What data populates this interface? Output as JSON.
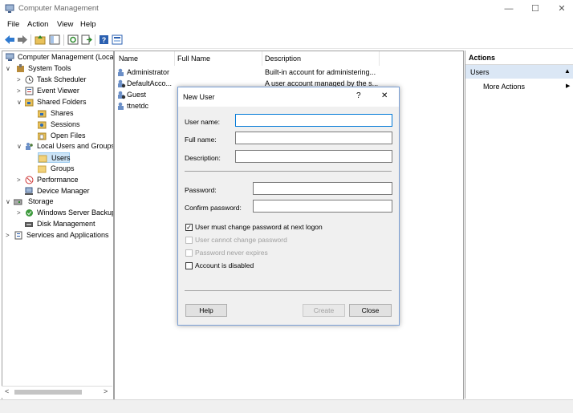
{
  "window": {
    "title": "Computer Management",
    "controls": {
      "minimize": "—",
      "maximize": "☐",
      "close": "✕"
    }
  },
  "menu": [
    "File",
    "Action",
    "View",
    "Help"
  ],
  "toolbar": [
    "back-icon",
    "forward-icon",
    "up-folder-icon",
    "show-hide-tree-icon",
    "refresh-icon",
    "export-list-icon",
    "help-icon",
    "properties-icon"
  ],
  "tree": {
    "items": [
      {
        "label": "Computer Management (Local",
        "icon": "computer-management-icon",
        "exp": ""
      },
      {
        "label": "System Tools",
        "icon": "tools-icon",
        "exp": "∨"
      },
      {
        "label": "Task Scheduler",
        "icon": "clock-icon",
        "exp": ">"
      },
      {
        "label": "Event Viewer",
        "icon": "event-viewer-icon",
        "exp": ">"
      },
      {
        "label": "Shared Folders",
        "icon": "shared-folder-icon",
        "exp": "∨"
      },
      {
        "label": "Shares",
        "icon": "shares-icon",
        "exp": ""
      },
      {
        "label": "Sessions",
        "icon": "sessions-icon",
        "exp": ""
      },
      {
        "label": "Open Files",
        "icon": "open-files-icon",
        "exp": ""
      },
      {
        "label": "Local Users and Groups",
        "icon": "users-groups-icon",
        "exp": "∨"
      },
      {
        "label": "Users",
        "icon": "folder-icon",
        "exp": ""
      },
      {
        "label": "Groups",
        "icon": "folder-icon",
        "exp": ""
      },
      {
        "label": "Performance",
        "icon": "performance-icon",
        "exp": ">"
      },
      {
        "label": "Device Manager",
        "icon": "device-manager-icon",
        "exp": ""
      },
      {
        "label": "Storage",
        "icon": "storage-icon",
        "exp": "∨"
      },
      {
        "label": "Windows Server Backup",
        "icon": "backup-icon",
        "exp": ">"
      },
      {
        "label": "Disk Management",
        "icon": "disk-icon",
        "exp": ""
      },
      {
        "label": "Services and Applications",
        "icon": "services-icon",
        "exp": ">"
      }
    ],
    "scroll_left": "<",
    "scroll_right": ">"
  },
  "list": {
    "columns": [
      "Name",
      "Full Name",
      "Description"
    ],
    "rows": [
      {
        "name": "Administrator",
        "full_name": "",
        "description": "Built-in account for administering..."
      },
      {
        "name": "DefaultAcco...",
        "full_name": "",
        "description": "A user account managed by the s..."
      },
      {
        "name": "Guest",
        "full_name": "",
        "description": ""
      },
      {
        "name": "ttnetdc",
        "full_name": "",
        "description": ""
      }
    ]
  },
  "actions": {
    "title": "Actions",
    "section": "Users",
    "section_arrow": "▲",
    "more_actions": "More Actions",
    "more_arrow": "▶"
  },
  "dialog": {
    "title": "New User",
    "help_glyph": "?",
    "close_glyph": "✕",
    "fields": {
      "user_name": {
        "label": "User name:",
        "value": ""
      },
      "full_name": {
        "label": "Full name:",
        "value": ""
      },
      "description": {
        "label": "Description:",
        "value": ""
      },
      "password": {
        "label": "Password:",
        "value": ""
      },
      "confirm_password": {
        "label": "Confirm password:",
        "value": ""
      }
    },
    "checkboxes": [
      {
        "label": "User must change password at next logon",
        "checked": true,
        "enabled": true
      },
      {
        "label": "User cannot change password",
        "checked": false,
        "enabled": false
      },
      {
        "label": "Password never expires",
        "checked": false,
        "enabled": false
      },
      {
        "label": "Account is disabled",
        "checked": false,
        "enabled": true
      }
    ],
    "buttons": {
      "help": "Help",
      "create": "Create",
      "close": "Close"
    }
  }
}
